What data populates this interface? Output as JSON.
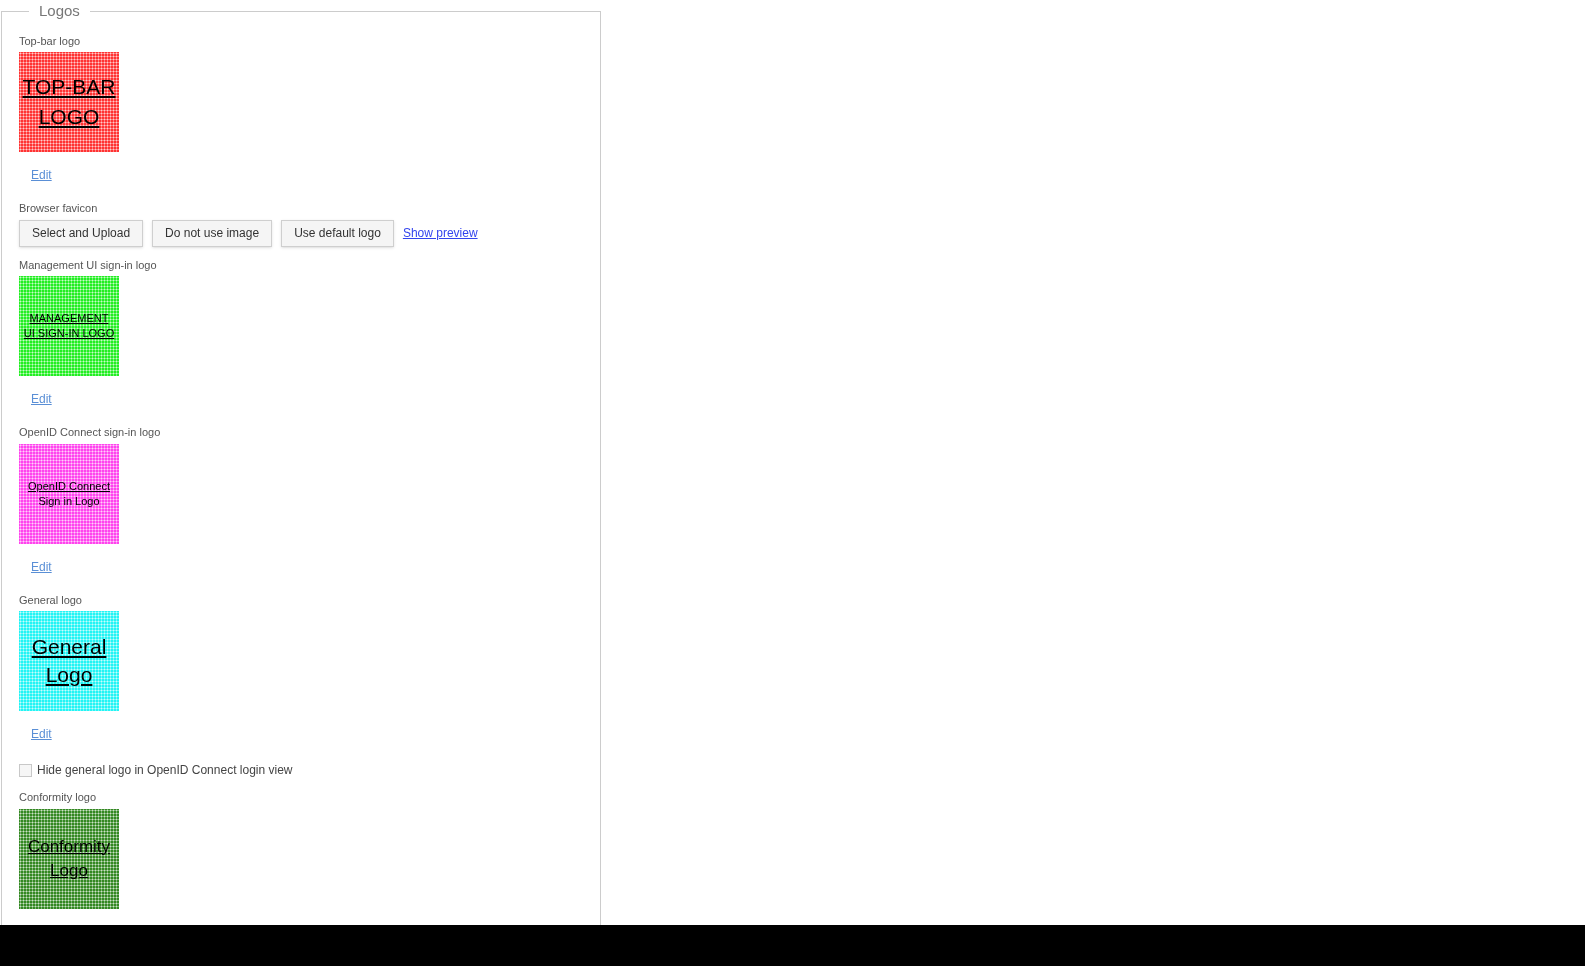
{
  "fieldset": {
    "legend": "Logos"
  },
  "sections": [
    {
      "kind": "logo",
      "label": "Top-bar logo",
      "color": "#ff3333",
      "image_lines": [
        {
          "text": "TOP-BAR",
          "underlined": true
        },
        {
          "text": "LOGO",
          "underlined": true
        }
      ],
      "edit": "Edit"
    },
    {
      "kind": "favicon",
      "label": "Browser favicon",
      "buttons": [
        "Select and Upload",
        "Do not use image",
        "Use default logo"
      ],
      "link": "Show preview"
    },
    {
      "kind": "logo",
      "label": "Management UI sign-in logo",
      "color": "#22ee22",
      "image_lines": [
        {
          "text": "MANAGEMENT",
          "underlined": true
        },
        {
          "text": "UI SIGN-IN LOGO",
          "underlined": true
        }
      ],
      "edit": "Edit"
    },
    {
      "kind": "logo",
      "label": "OpenID Connect sign-in logo",
      "color": "#ff44ee",
      "image_lines": [
        {
          "text": "OpenID Connect",
          "underlined": true
        },
        {
          "text": "Sign in Logo",
          "underlined": false
        }
      ],
      "edit": "Edit"
    },
    {
      "kind": "logo",
      "label": "General logo",
      "color": "#22f4f4",
      "image_lines": [
        {
          "text": "General",
          "underlined": true
        },
        {
          "text": "Logo",
          "underlined": true
        }
      ],
      "edit": "Edit"
    },
    {
      "kind": "checkbox",
      "label": "Hide general logo in OpenID Connect login view",
      "checked": false
    },
    {
      "kind": "logo",
      "label": "Conformity logo",
      "color": "#338822",
      "image_lines": [
        {
          "text": "Conformity",
          "underlined": true
        },
        {
          "text": "Logo",
          "underlined": true
        }
      ]
    }
  ]
}
